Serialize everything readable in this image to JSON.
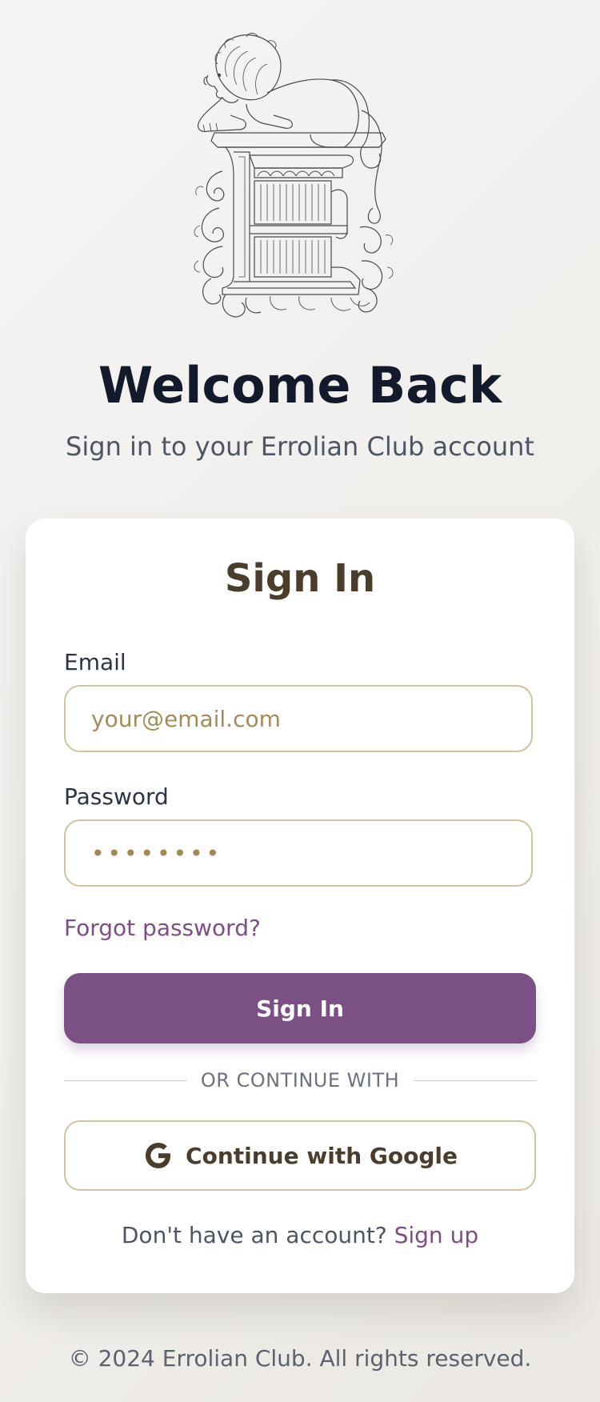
{
  "header": {
    "logo_icon": "lion-letter-e-emblem",
    "title": "Welcome Back",
    "subtitle": "Sign in to your Errolian Club account"
  },
  "form": {
    "title": "Sign In",
    "email_label": "Email",
    "email_placeholder": "your@email.com",
    "email_value": "",
    "password_label": "Password",
    "password_value": "••••••••",
    "forgot_password": "Forgot password?",
    "submit_label": "Sign In",
    "divider_text": "OR CONTINUE WITH",
    "google_icon": "google-g-icon",
    "google_label": "Continue with Google",
    "signup_prompt": "Don't have an account?",
    "signup_link": "Sign up"
  },
  "footer": {
    "text": "© 2024 Errolian Club. All rights reserved."
  },
  "colors": {
    "accent": "#7b5185",
    "link": "#7b4f85",
    "field_border": "#d3c29c",
    "heading_dark": "#131a2b",
    "brown": "#4a3d2c"
  }
}
